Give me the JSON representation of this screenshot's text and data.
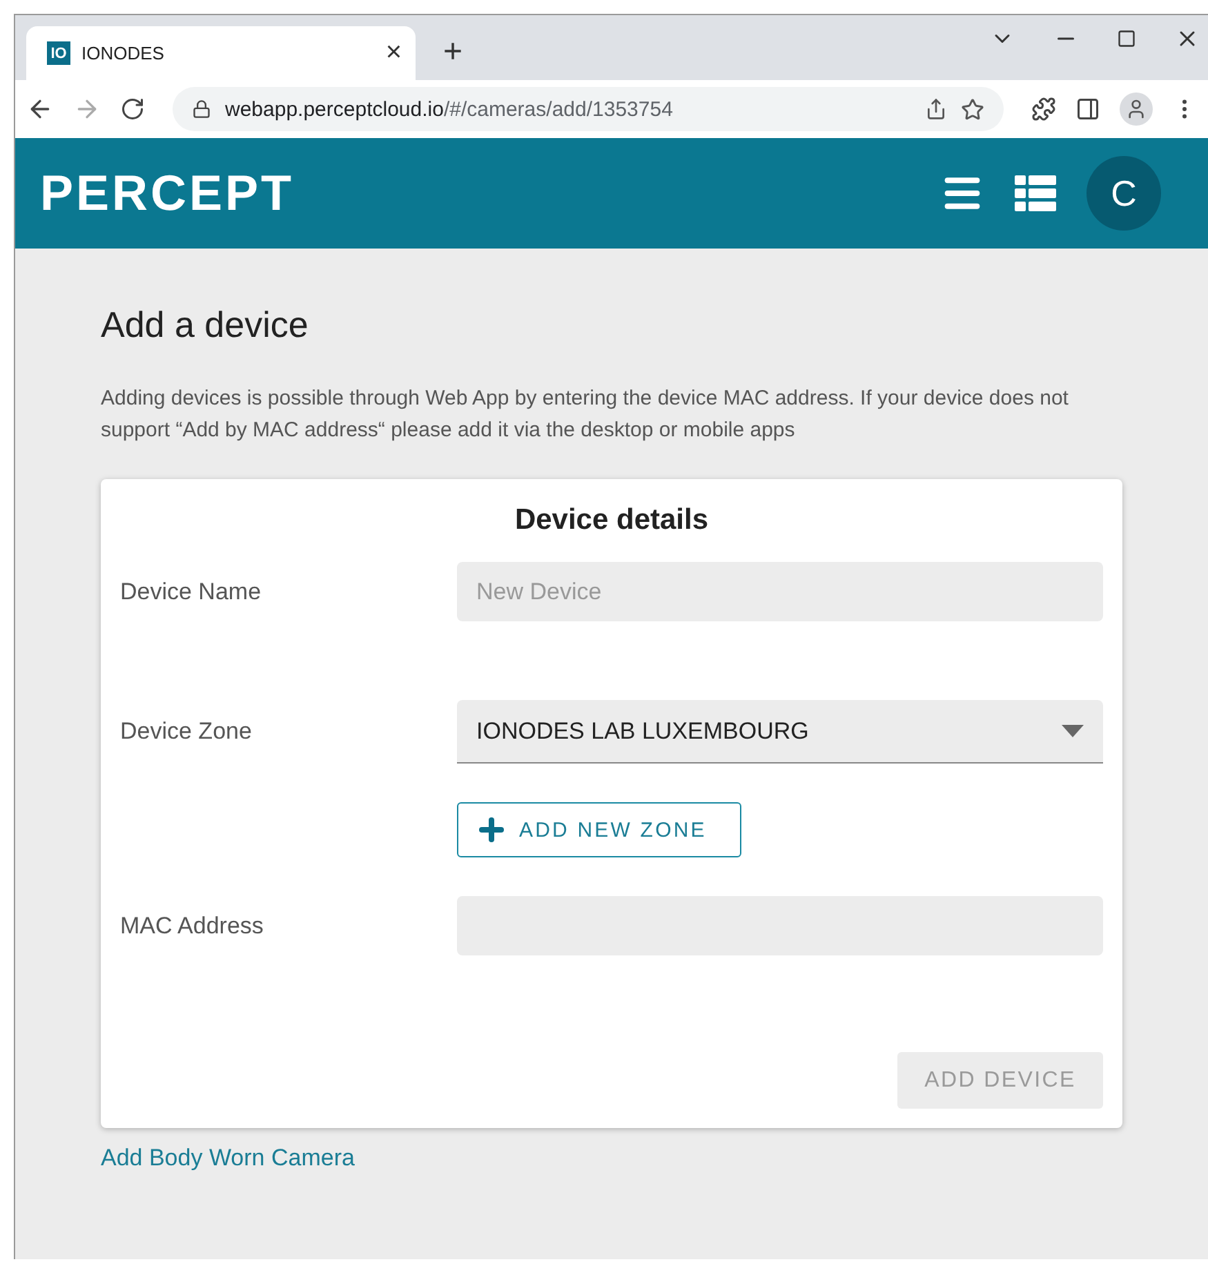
{
  "browser": {
    "tab": {
      "favicon": "IO",
      "title": "IONODES",
      "close": "×"
    },
    "new_tab": "+",
    "url_host": "webapp.perceptcloud.io",
    "url_path": "/#/cameras/add/1353754"
  },
  "header": {
    "logo": "PERCEPT",
    "avatar": "C"
  },
  "page": {
    "title": "Add a device",
    "description": "Adding devices is possible through Web App by entering the device MAC address. If your device does not support “Add by MAC address“ please add it via the desktop or mobile apps"
  },
  "card": {
    "title": "Device details",
    "fields": [
      {
        "kind": "input",
        "label": "Device Name",
        "placeholder": "New Device"
      },
      {
        "kind": "select",
        "label": "Device Zone",
        "value": "IONODES LAB LUXEMBOURG"
      },
      {
        "kind": "input",
        "label": "MAC Address"
      }
    ],
    "zone_button": "ADD NEW ZONE",
    "submit": {
      "label": "ADD DEVICE",
      "disabled": true
    }
  },
  "footer_link": "Add Body Worn Camera"
}
